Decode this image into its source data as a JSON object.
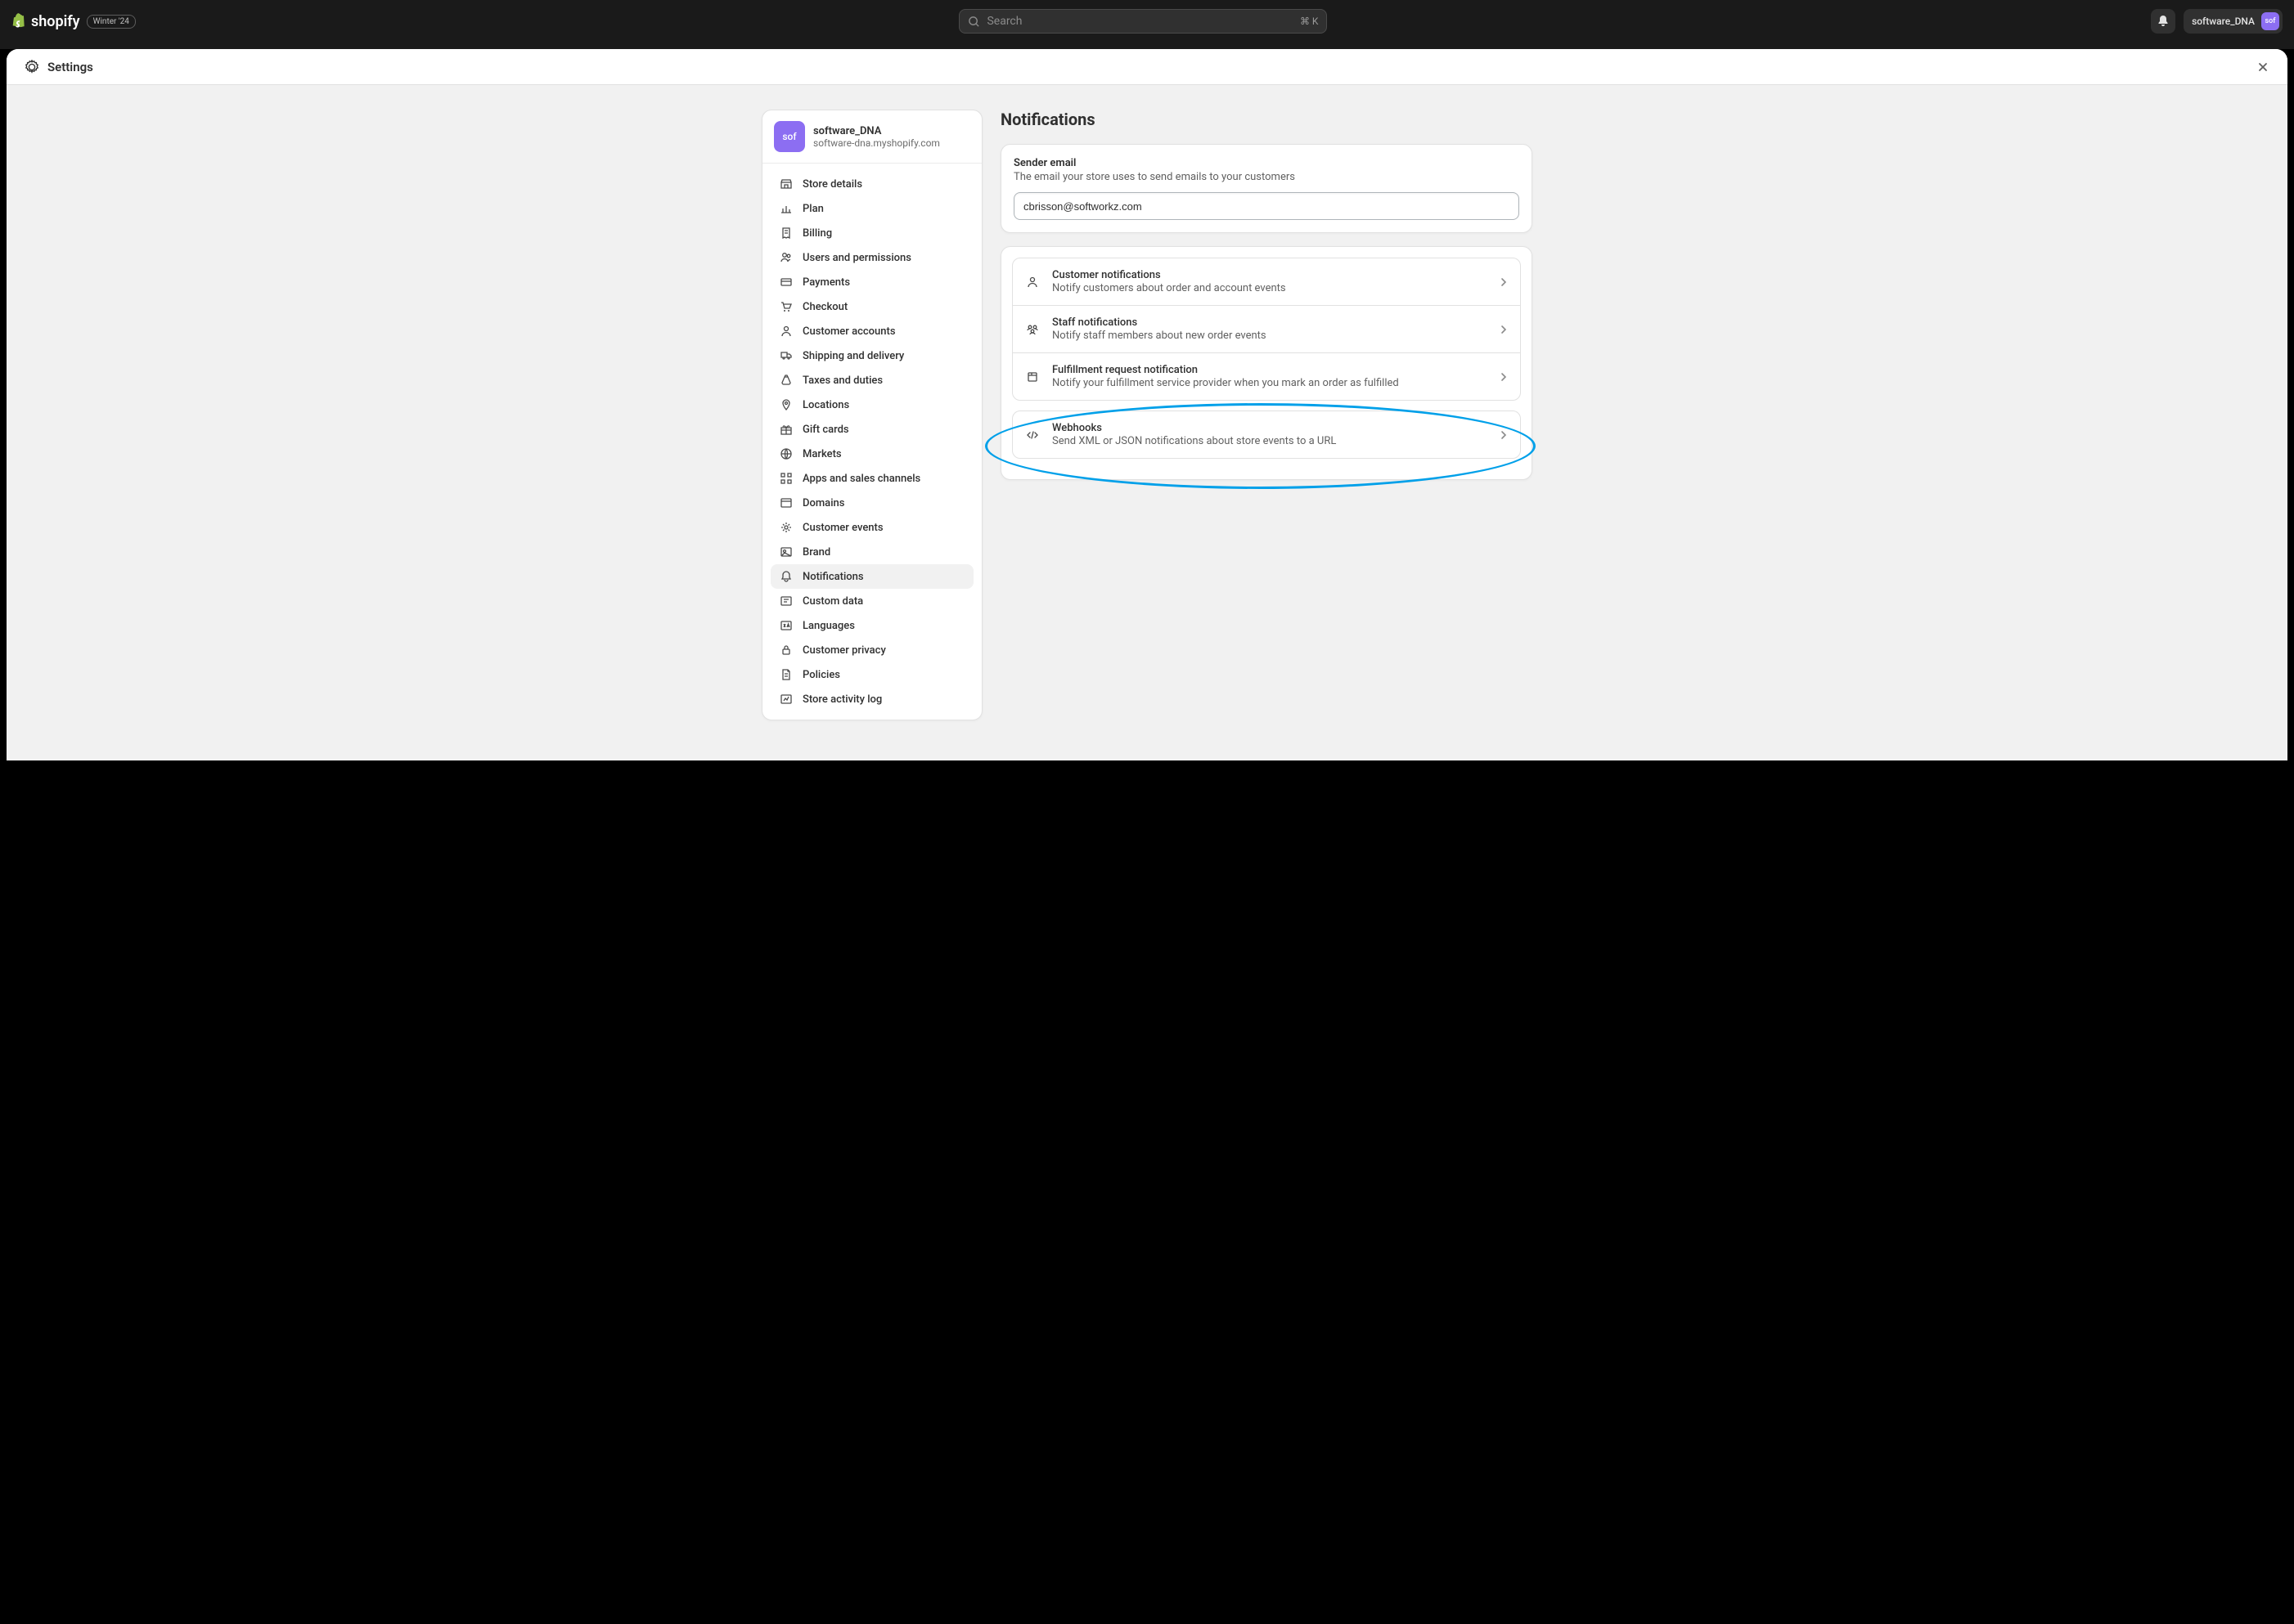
{
  "header": {
    "brand": "shopify",
    "badge": "Winter '24",
    "search_placeholder": "Search",
    "search_shortcut": "⌘ K",
    "username": "software_DNA",
    "avatar_text": "sof"
  },
  "modal": {
    "title": "Settings"
  },
  "store": {
    "avatar_text": "sof",
    "name": "software_DNA",
    "url": "software-dna.myshopify.com"
  },
  "nav": {
    "items": [
      {
        "id": "store-details",
        "label": "Store details",
        "icon": "store"
      },
      {
        "id": "plan",
        "label": "Plan",
        "icon": "chart"
      },
      {
        "id": "billing",
        "label": "Billing",
        "icon": "receipt"
      },
      {
        "id": "users",
        "label": "Users and permissions",
        "icon": "users"
      },
      {
        "id": "payments",
        "label": "Payments",
        "icon": "card"
      },
      {
        "id": "checkout",
        "label": "Checkout",
        "icon": "cart"
      },
      {
        "id": "customer-accounts",
        "label": "Customer accounts",
        "icon": "person"
      },
      {
        "id": "shipping",
        "label": "Shipping and delivery",
        "icon": "truck"
      },
      {
        "id": "taxes",
        "label": "Taxes and duties",
        "icon": "sack"
      },
      {
        "id": "locations",
        "label": "Locations",
        "icon": "pin"
      },
      {
        "id": "gift",
        "label": "Gift cards",
        "icon": "gift"
      },
      {
        "id": "markets",
        "label": "Markets",
        "icon": "globe"
      },
      {
        "id": "apps",
        "label": "Apps and sales channels",
        "icon": "apps"
      },
      {
        "id": "domains",
        "label": "Domains",
        "icon": "domain"
      },
      {
        "id": "events",
        "label": "Customer events",
        "icon": "burst"
      },
      {
        "id": "brand",
        "label": "Brand",
        "icon": "brand"
      },
      {
        "id": "notifications",
        "label": "Notifications",
        "icon": "bell",
        "active": true
      },
      {
        "id": "custom",
        "label": "Custom data",
        "icon": "data"
      },
      {
        "id": "languages",
        "label": "Languages",
        "icon": "lang"
      },
      {
        "id": "privacy",
        "label": "Customer privacy",
        "icon": "lock"
      },
      {
        "id": "policies",
        "label": "Policies",
        "icon": "policy"
      },
      {
        "id": "activity",
        "label": "Store activity log",
        "icon": "activity"
      }
    ]
  },
  "content": {
    "title": "Notifications",
    "sender_email": {
      "label": "Sender email",
      "description": "The email your store uses to send emails to your customers",
      "value": "cbrisson@softworkz.com"
    },
    "groups": [
      [
        {
          "id": "customer",
          "title": "Customer notifications",
          "desc": "Notify customers about order and account events",
          "icon": "person"
        },
        {
          "id": "staff",
          "title": "Staff notifications",
          "desc": "Notify staff members about new order events",
          "icon": "people"
        },
        {
          "id": "fulfillment",
          "title": "Fulfillment request notification",
          "desc": "Notify your fulfillment service provider when you mark an order as fulfilled",
          "icon": "box"
        }
      ],
      [
        {
          "id": "webhooks",
          "title": "Webhooks",
          "desc": "Send XML or JSON notifications about store events to a URL",
          "icon": "code",
          "highlighted": true
        }
      ]
    ]
  }
}
